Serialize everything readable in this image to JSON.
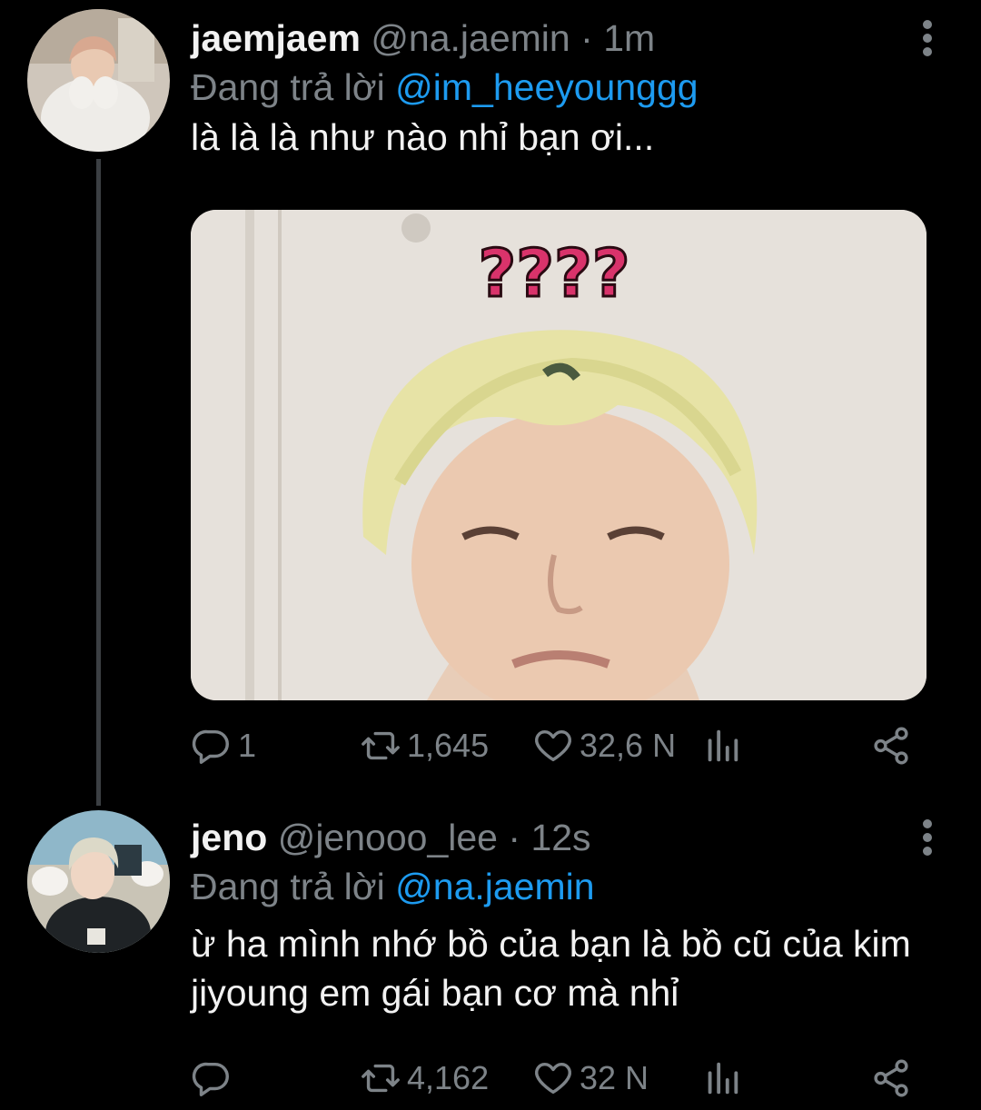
{
  "tweets": [
    {
      "display_name": "jaemjaem",
      "handle": "@na.jaemin",
      "separator": "·",
      "time": "1m",
      "reply_prefix": "Đang trả lời",
      "reply_to": "@im_heeyounggg",
      "text": "là là là như nào nhỉ bạn ơi...",
      "media_text": "????",
      "reply_count": "1",
      "retweet_count": "1,645",
      "like_count": "32,6 N"
    },
    {
      "display_name": "jeno",
      "handle": "@jenooo_lee",
      "separator": "·",
      "time": "12s",
      "reply_prefix": "Đang trả lời",
      "reply_to": "@na.jaemin",
      "text": "ừ ha mình nhớ bồ của bạn là bồ cũ của kim jiyoung em gái bạn cơ mà nhỉ",
      "reply_count": "",
      "retweet_count": "4,162",
      "like_count": "32 N"
    }
  ],
  "icons": {
    "reply": "reply-icon",
    "retweet": "retweet-icon",
    "like": "heart-icon",
    "analytics": "analytics-icon",
    "share": "share-icon",
    "more": "more-vertical-icon"
  },
  "colors": {
    "background": "#000000",
    "text": "#f2f2f2",
    "secondary": "#7d8388",
    "link": "#1d9bf0",
    "thread_line": "#3b3f43"
  }
}
